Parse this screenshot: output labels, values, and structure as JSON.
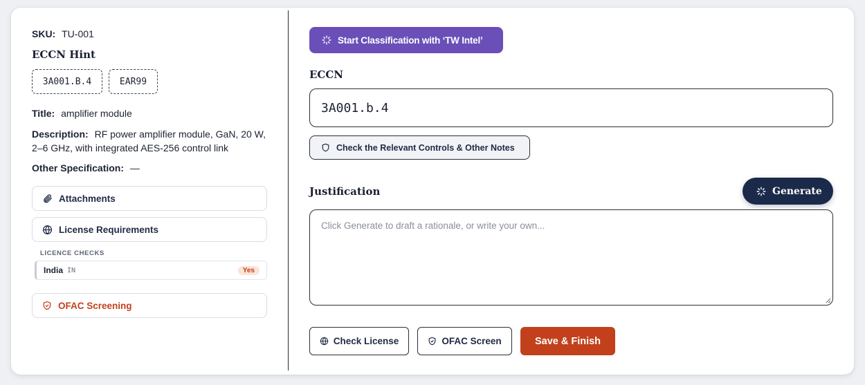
{
  "left": {
    "sku_label": "SKU:",
    "sku_value": "TU-001",
    "eccn_hint_title": "ECCN Hint",
    "eccn_chips": [
      "3A001.B.4",
      "EAR99"
    ],
    "title_label": "Title:",
    "title_value": "amplifier module",
    "description_label": "Description:",
    "description_value": "RF power amplifier module, GaN, 20 W, 2–6 GHz, with integrated AES-256 control link",
    "other_spec_label": "Other Specification:",
    "other_spec_value": "—",
    "attachments_label": "Attachments",
    "license_requirements_label": "License Requirements",
    "licence_checks_label": "LICENCE CHECKS",
    "licence_row": {
      "country": "India",
      "code": "IN",
      "status": "Yes"
    },
    "ofac_label": "OFAC Screening"
  },
  "right": {
    "start_button": "Start Classification with ‘TW Intel’",
    "eccn_label": "ECCN",
    "eccn_value": "3A001.b.4",
    "controls_button": "Check the Relevant Controls & Other Notes",
    "justification_label": "Justification",
    "generate_button": "Generate",
    "justification_placeholder": "Click Generate to draft a rationale, or write your own...",
    "check_license_button": "Check License",
    "ofac_screen_button": "OFAC Screen",
    "save_finish_button": "Save & Finish"
  },
  "colors": {
    "accent_purple": "#6a4fb8",
    "navy": "#1b2a4a",
    "brand_orange": "#c2411c"
  },
  "icons": [
    "spinner-icon",
    "paperclip-icon",
    "globe-icon",
    "shield-icon"
  ]
}
